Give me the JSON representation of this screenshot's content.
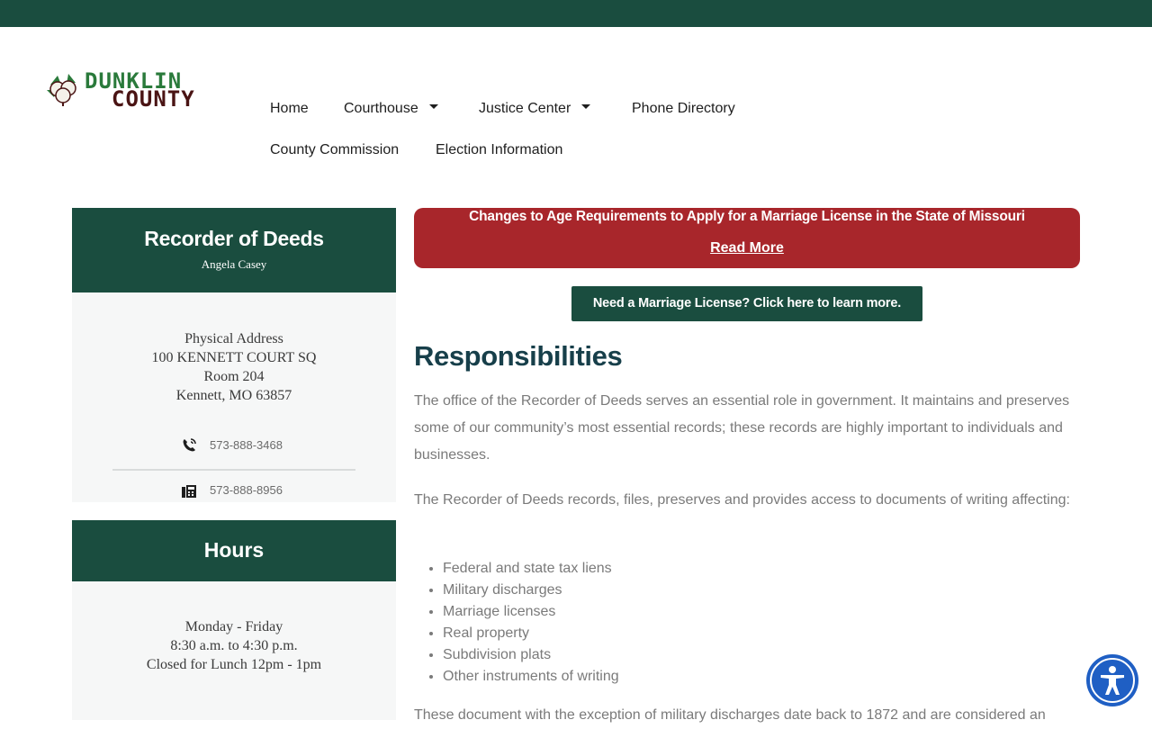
{
  "logo": {
    "line1": "DUNKLIN",
    "line2": "COUNTY"
  },
  "nav": {
    "items": [
      {
        "label": "Home"
      },
      {
        "label": "Courthouse"
      },
      {
        "label": "Justice Center"
      },
      {
        "label": "Phone Directory"
      },
      {
        "label": "County Commission"
      },
      {
        "label": "Election Information"
      }
    ]
  },
  "recorder": {
    "title": "Recorder of Deeds",
    "name": "Angela Casey",
    "address": [
      "Physical Address",
      "100 KENNETT COURT SQ",
      "Room 204",
      "Kennett, MO 63857"
    ],
    "phone": "573-888-3468",
    "fax": "573-888-8956"
  },
  "hours": {
    "title": "Hours",
    "lines": [
      "Monday - Friday",
      "8:30 a.m. to 4:30 p.m.",
      "Closed for Lunch 12pm - 1pm"
    ]
  },
  "alert": {
    "text": "Changes to Age Requirements to Apply for a Marriage License in the State of Missouri",
    "link": "Read More"
  },
  "marriage_button": "Need a Marriage License? Click here to learn more.",
  "main": {
    "heading": "Responsibilities",
    "p1": "The office of the Recorder of Deeds serves an essential role in government. It maintains and preserves some of our community’s most essential records; these records are highly important to individuals and businesses.",
    "p2": "The Recorder of Deeds records, files, preserves and provides access to documents of writing affecting:",
    "list": [
      "Federal and state tax liens",
      "Military discharges",
      "Marriage licenses",
      "Real property",
      "Subdivision plats",
      "Other instruments of writing"
    ],
    "p3": "These document with the exception of military discharges date back to 1872 and are considered an"
  },
  "colors": {
    "brand_green": "#1a4d3f",
    "alert_red": "#a8262b",
    "heading": "#173f4a",
    "a11y_blue": "#1f5fc4"
  },
  "icons": [
    "cotton-boll-icon",
    "phone-icon",
    "fax-icon",
    "caret-down-icon",
    "accessibility-icon"
  ]
}
